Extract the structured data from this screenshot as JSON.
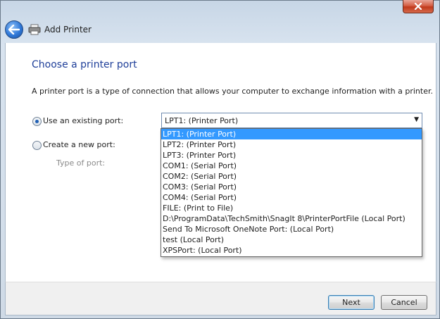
{
  "window": {
    "title": "Add Printer"
  },
  "page": {
    "heading": "Choose a printer port",
    "description": "A printer port is a type of connection that allows your computer to exchange information with a printer."
  },
  "port": {
    "existing_label": "Use an existing port:",
    "new_label": "Create a new port:",
    "type_label": "Type of port:",
    "selected": "LPT1: (Printer Port)",
    "options": [
      "LPT1: (Printer Port)",
      "LPT2: (Printer Port)",
      "LPT3: (Printer Port)",
      "COM1: (Serial Port)",
      "COM2: (Serial Port)",
      "COM3: (Serial Port)",
      "COM4: (Serial Port)",
      "FILE: (Print to File)",
      "D:\\ProgramData\\TechSmith\\SnagIt 8\\PrinterPortFile (Local Port)",
      "Send To Microsoft OneNote Port: (Local Port)",
      "test (Local Port)",
      "XPSPort: (Local Port)"
    ]
  },
  "buttons": {
    "next": "Next",
    "cancel": "Cancel"
  },
  "icons": {
    "back": "back-arrow-icon",
    "printer": "printer-icon",
    "close": "close-icon",
    "dropdown": "chevron-down-icon"
  },
  "colors": {
    "heading": "#1f3f99",
    "selection": "#3399ff",
    "close_button": "#c0391b"
  }
}
